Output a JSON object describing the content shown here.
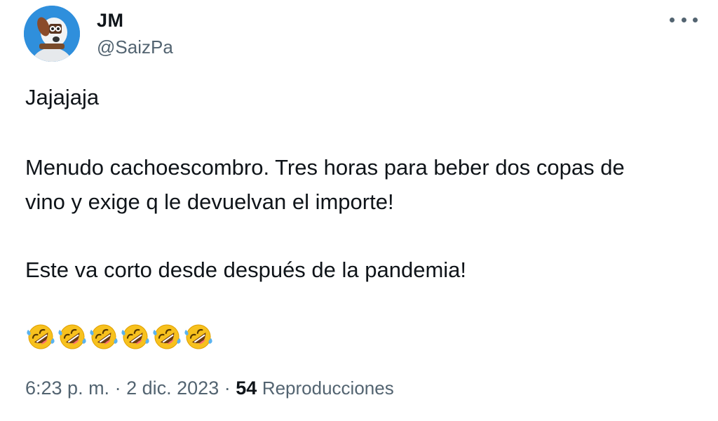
{
  "author": {
    "display_name": "JM",
    "handle": "@SaizPa",
    "avatar_icon": "avatar-dog-icon"
  },
  "menu": {
    "icon": "more-options-icon"
  },
  "tweet": {
    "lines": [
      "Jajajaja",
      "Menudo cachoescombro. Tres horas para beber dos copas de",
      "vino y exige q le devuelvan el importe!",
      "Este va corto desde después de la pandemia!"
    ],
    "emoji_icon": "rolling-on-floor-laughing-icon",
    "emoji_count": 6
  },
  "meta": {
    "time": "6:23 p. m.",
    "separator": "·",
    "date": "2 dic. 2023",
    "views_count": "54",
    "views_label": "Reproducciones"
  },
  "colors": {
    "text": "#0f1419",
    "secondary": "#536471",
    "avatar_bg": "#2f8fdc",
    "emoji_yellow": "#f7c11e",
    "tears": "#5ab3f0"
  }
}
